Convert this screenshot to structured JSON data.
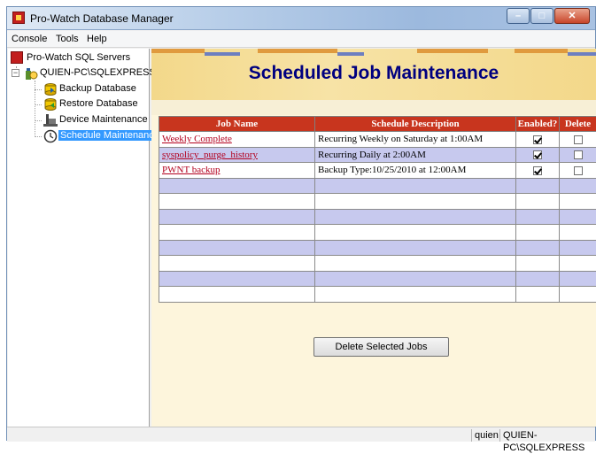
{
  "window": {
    "title": "Pro-Watch Database Manager"
  },
  "menu": {
    "items": [
      "Console",
      "Tools",
      "Help"
    ]
  },
  "tree": {
    "root": "Pro-Watch SQL Servers",
    "server": "QUIEN-PC\\SQLEXPRESS",
    "items": [
      "Backup Database",
      "Restore Database",
      "Device Maintenance",
      "Schedule Maintenance"
    ],
    "selected_index": 3
  },
  "page": {
    "title": "Scheduled Job Maintenance"
  },
  "table": {
    "headers": [
      "Job Name",
      "Schedule Description",
      "Enabled?",
      "Delete"
    ],
    "rows": [
      {
        "name": "Weekly Complete",
        "schedule": "Recurring Weekly on Saturday at 1:00AM",
        "enabled": true,
        "delete": false
      },
      {
        "name": "syspolicy_purge_history",
        "schedule": "Recurring Daily at 2:00AM",
        "enabled": true,
        "delete": false
      },
      {
        "name": "PWNT backup",
        "schedule": "Backup Type:10/25/2010 at 12:00AM",
        "enabled": true,
        "delete": false
      }
    ],
    "empty_rows": 8
  },
  "buttons": {
    "delete_label": "Delete Selected Jobs"
  },
  "status": {
    "user": "quien",
    "server": "QUIEN-PC\\SQLEXPRESS"
  },
  "colors": {
    "header_red": "#c8351e",
    "link_red": "#b3001e",
    "row_blue": "#c7c9ee",
    "title_navy": "#000080",
    "selection": "#3399ff"
  }
}
